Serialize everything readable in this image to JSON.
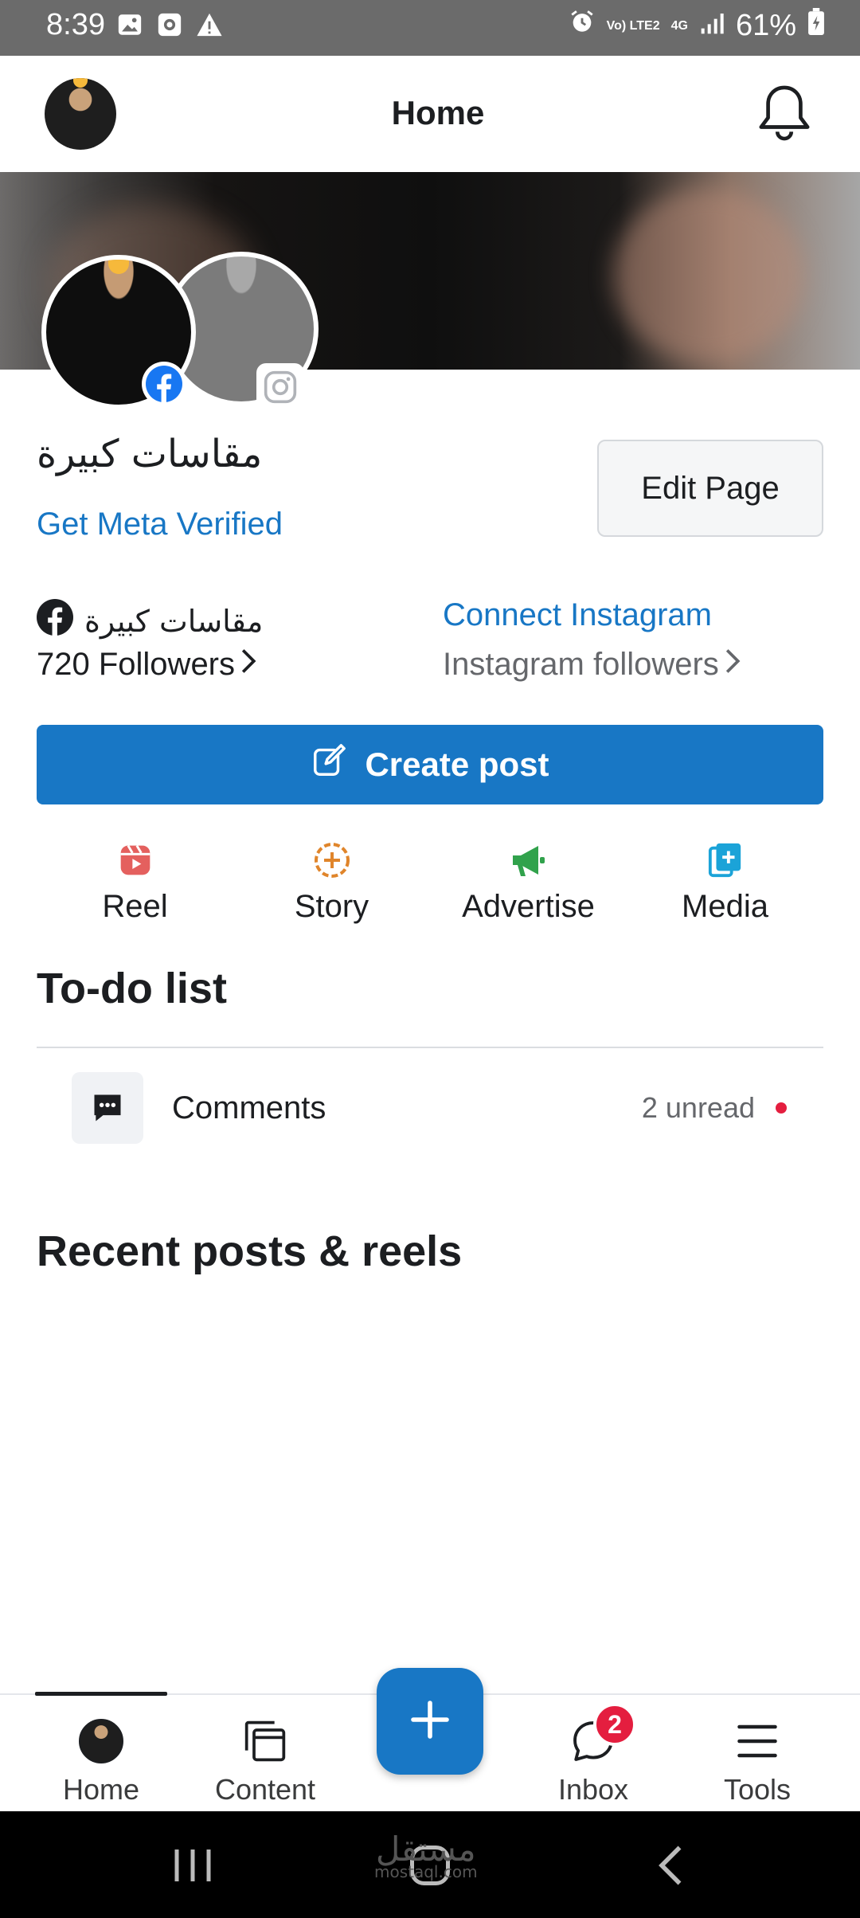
{
  "status_bar": {
    "time": "8:39",
    "battery": "61%",
    "network": "4G",
    "volte": "Vo) LTE2"
  },
  "header": {
    "title": "Home"
  },
  "page": {
    "name": "مقاسات كبيرة",
    "meta_verified": "Get Meta Verified",
    "edit_label": "Edit Page",
    "fb_name": "مقاسات كبيرة",
    "fb_followers": "720 Followers",
    "connect_instagram": "Connect Instagram",
    "ig_followers": "Instagram followers"
  },
  "create_post": {
    "label": "Create post"
  },
  "actions": [
    {
      "label": "Reel",
      "icon": "reel-icon",
      "color": "#e4605e"
    },
    {
      "label": "Story",
      "icon": "story-icon",
      "color": "#e0852b"
    },
    {
      "label": "Advertise",
      "icon": "megaphone-icon",
      "color": "#31a24c"
    },
    {
      "label": "Media",
      "icon": "media-icon",
      "color": "#1ba3d8"
    }
  ],
  "todo": {
    "title": "To-do list",
    "items": [
      {
        "label": "Comments",
        "count": "2 unread"
      }
    ]
  },
  "recent": {
    "title": "Recent posts & reels"
  },
  "bottom_nav": {
    "items": [
      {
        "label": "Home",
        "icon": "avatar-icon"
      },
      {
        "label": "Content",
        "icon": "content-icon"
      },
      {
        "label": "Inbox",
        "icon": "inbox-icon",
        "badge": "2"
      },
      {
        "label": "Tools",
        "icon": "menu-icon"
      }
    ]
  },
  "watermark": {
    "text": "مستقل",
    "sub": "mostaql.com"
  },
  "colors": {
    "accent": "#1877c5",
    "notification": "#e41e3f"
  }
}
